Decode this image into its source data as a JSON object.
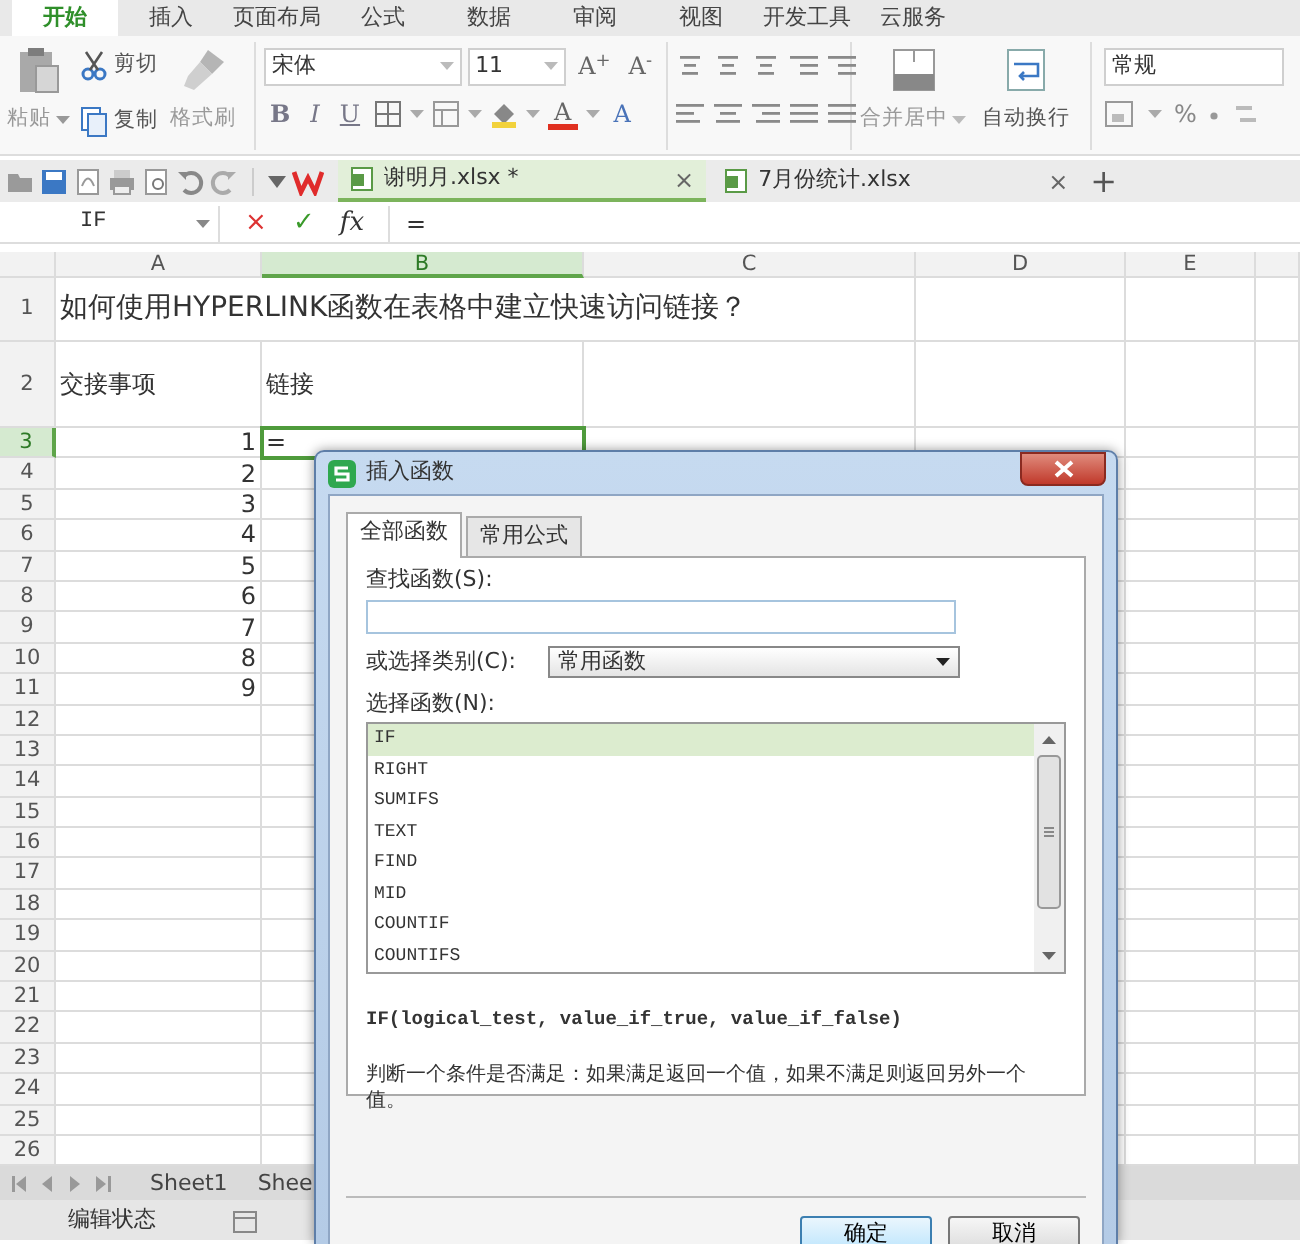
{
  "menu_tabs": [
    {
      "label": "开始",
      "selected": true
    },
    {
      "label": "插入",
      "selected": false
    },
    {
      "label": "页面布局",
      "selected": false
    },
    {
      "label": "公式",
      "selected": false
    },
    {
      "label": "数据",
      "selected": false
    },
    {
      "label": "审阅",
      "selected": false
    },
    {
      "label": "视图",
      "selected": false
    },
    {
      "label": "开发工具",
      "selected": false
    },
    {
      "label": "云服务",
      "selected": false
    }
  ],
  "ribbon": {
    "paste": "粘贴",
    "cut": "剪切",
    "copy": "复制",
    "format_painter": "格式刷",
    "font_name": "宋体",
    "font_size": "11",
    "size_buttons": [
      "A$^{+}$",
      "A$^{-}$"
    ],
    "style_buttons": [
      "B",
      "I",
      "U"
    ],
    "font_color": "A",
    "clear_format": "A",
    "merge_center": "合并居中",
    "wrap_text": "自动换行",
    "number_format": "常规",
    "percent": "%"
  },
  "doc_tabs": [
    {
      "name": "谢明月.xlsx *",
      "selected": true,
      "close": "×"
    },
    {
      "name": "7月份统计.xlsx",
      "selected": false,
      "close": "×"
    }
  ],
  "new_tab": "+",
  "formula_bar": {
    "name_box": "IF",
    "cancel": "×",
    "enter": "✓",
    "fx": "fx",
    "formula": "="
  },
  "sheet": {
    "columns": [
      {
        "label": "A",
        "selected": false
      },
      {
        "label": "B",
        "selected": true
      },
      {
        "label": "C",
        "selected": false
      },
      {
        "label": "D",
        "selected": false
      },
      {
        "label": "E",
        "selected": false
      }
    ],
    "rows": [
      {
        "number": "1",
        "selected": false,
        "cells": {
          "A": {
            "kind": "title",
            "text": "如何使用HYPERLINK函数在表格中建立快速访问链接？",
            "selected": false
          }
        }
      },
      {
        "number": "2",
        "selected": false,
        "cells": {
          "A": {
            "kind": "text",
            "text": "交接事项",
            "selected": false
          },
          "B": {
            "kind": "text",
            "text": "链接",
            "selected": false
          }
        }
      },
      {
        "number": "3",
        "selected": true,
        "cells": {
          "A": {
            "kind": "number",
            "text": "1",
            "selected": false
          },
          "B": {
            "kind": "text",
            "text": "=",
            "selected": true
          }
        }
      },
      {
        "number": "4",
        "selected": false,
        "cells": {
          "A": {
            "kind": "number",
            "text": "2",
            "selected": false
          }
        }
      },
      {
        "number": "5",
        "selected": false,
        "cells": {
          "A": {
            "kind": "number",
            "text": "3",
            "selected": false
          }
        }
      },
      {
        "number": "6",
        "selected": false,
        "cells": {
          "A": {
            "kind": "number",
            "text": "4",
            "selected": false
          }
        }
      },
      {
        "number": "7",
        "selected": false,
        "cells": {
          "A": {
            "kind": "number",
            "text": "5",
            "selected": false
          }
        }
      },
      {
        "number": "8",
        "selected": false,
        "cells": {
          "A": {
            "kind": "number",
            "text": "6",
            "selected": false
          }
        }
      },
      {
        "number": "9",
        "selected": false,
        "cells": {
          "A": {
            "kind": "number",
            "text": "7",
            "selected": false
          }
        }
      },
      {
        "number": "10",
        "selected": false,
        "cells": {
          "A": {
            "kind": "number",
            "text": "8",
            "selected": false
          }
        }
      },
      {
        "number": "11",
        "selected": false,
        "cells": {
          "A": {
            "kind": "number",
            "text": "9",
            "selected": false
          }
        }
      },
      {
        "number": "12",
        "selected": false
      },
      {
        "number": "13",
        "selected": false
      },
      {
        "number": "14",
        "selected": false
      },
      {
        "number": "15",
        "selected": false
      },
      {
        "number": "16",
        "selected": false
      },
      {
        "number": "17",
        "selected": false
      },
      {
        "number": "18",
        "selected": false
      },
      {
        "number": "19",
        "selected": false
      },
      {
        "number": "20",
        "selected": false
      },
      {
        "number": "21",
        "selected": false
      },
      {
        "number": "22",
        "selected": false
      },
      {
        "number": "23",
        "selected": false
      },
      {
        "number": "24",
        "selected": false
      },
      {
        "number": "25",
        "selected": false
      },
      {
        "number": "26",
        "selected": false
      }
    ]
  },
  "sheet_tabs": [
    "Sheet1",
    "Shee"
  ],
  "status_bar": {
    "mode": "编辑状态"
  },
  "dialog": {
    "title": "插入函数",
    "tabs": [
      {
        "label": "全部函数",
        "selected": true
      },
      {
        "label": "常用公式",
        "selected": false
      }
    ],
    "search_label": "查找函数(S):",
    "category_label": "或选择类别(C):",
    "category": "常用函数",
    "function_label": "选择函数(N):",
    "functions": [
      {
        "name": "IF",
        "selected": true
      },
      {
        "name": "RIGHT",
        "selected": false
      },
      {
        "name": "SUMIFS",
        "selected": false
      },
      {
        "name": "TEXT",
        "selected": false
      },
      {
        "name": "FIND",
        "selected": false
      },
      {
        "name": "MID",
        "selected": false
      },
      {
        "name": "COUNTIF",
        "selected": false
      },
      {
        "name": "COUNTIFS",
        "selected": false
      }
    ],
    "signature": "IF(logical_test, value_if_true, value_if_false)",
    "description": "判断一个条件是否满足：如果满足返回一个值，如果不满足则返回另外一个值。",
    "buttons": [
      {
        "label": "确定",
        "kind": "primary"
      },
      {
        "label": "取消",
        "kind": "secondary"
      }
    ]
  }
}
